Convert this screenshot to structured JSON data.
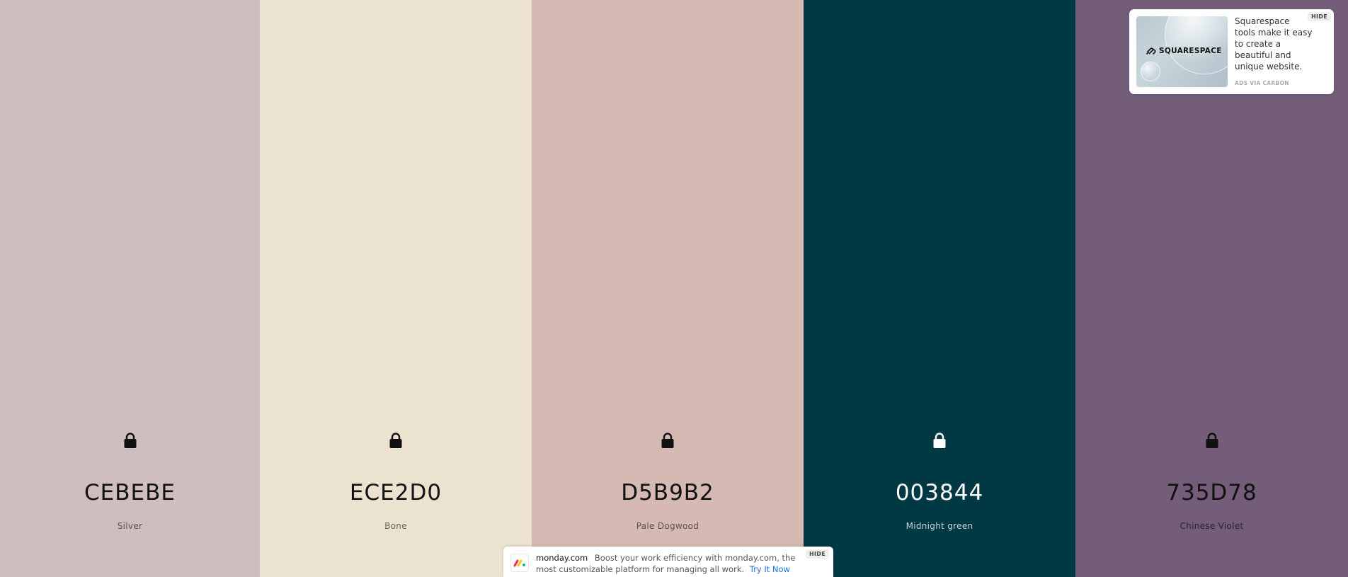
{
  "palette": {
    "colors": [
      {
        "hex": "CEBEBE",
        "name": "Silver",
        "bg": "#CEBEBE",
        "text_color": "#111111",
        "name_color": "#5a5050"
      },
      {
        "hex": "ECE2D0",
        "name": "Bone",
        "bg": "#ECE2D0",
        "text_color": "#111111",
        "name_color": "#6b655a"
      },
      {
        "hex": "D5B9B2",
        "name": "Pale Dogwood",
        "bg": "#D5B9B2",
        "text_color": "#111111",
        "name_color": "#5e514e"
      },
      {
        "hex": "003844",
        "name": "Midnight green",
        "bg": "#003844",
        "text_color": "#ffffff",
        "name_color": "#c6d3d6"
      },
      {
        "hex": "735D78",
        "name": "Chinese Violet",
        "bg": "#735D78",
        "text_color": "#111111",
        "name_color": "#2a2230"
      }
    ],
    "lock_icon": "lock-icon"
  },
  "carbon_ad": {
    "image_brand": "SQUARESPACE",
    "text": "Squarespace tools make it easy to create a beautiful and unique website.",
    "via": "ADS VIA CARBON",
    "hide_label": "HIDE"
  },
  "monday_ad": {
    "brand": "monday.com",
    "text": "Boost your work efficiency with monday.com, the most customizable platform for managing all work.",
    "cta": "Try It Now",
    "hide_label": "HIDE"
  }
}
